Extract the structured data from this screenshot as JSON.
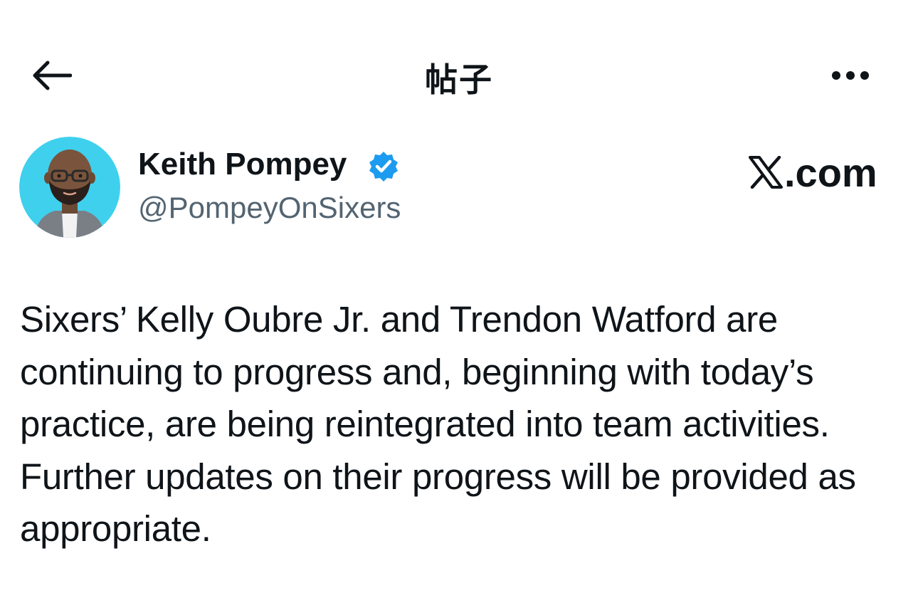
{
  "header": {
    "title": "帖子",
    "back_icon": "arrow-left-icon",
    "more_icon": "more-horizontal-icon"
  },
  "author": {
    "name": "Keith Pompey",
    "handle": "@PompeyOnSixers",
    "verified": true,
    "avatar_icon": "avatar-memoji"
  },
  "brand": {
    "text": ".com",
    "logo_icon": "x-logo-icon"
  },
  "post": {
    "text": "Sixers’ Kelly Oubre Jr. and Trendon Watford are continuing to progress and, beginning with today’s practice, are being reintegrated into team activities. Further updates on their progress will be provided as appropriate."
  },
  "colors": {
    "text_primary": "#0f1419",
    "text_secondary": "#536471",
    "verified_blue": "#1d9bf0",
    "avatar_bg": "#3fd0ee"
  }
}
